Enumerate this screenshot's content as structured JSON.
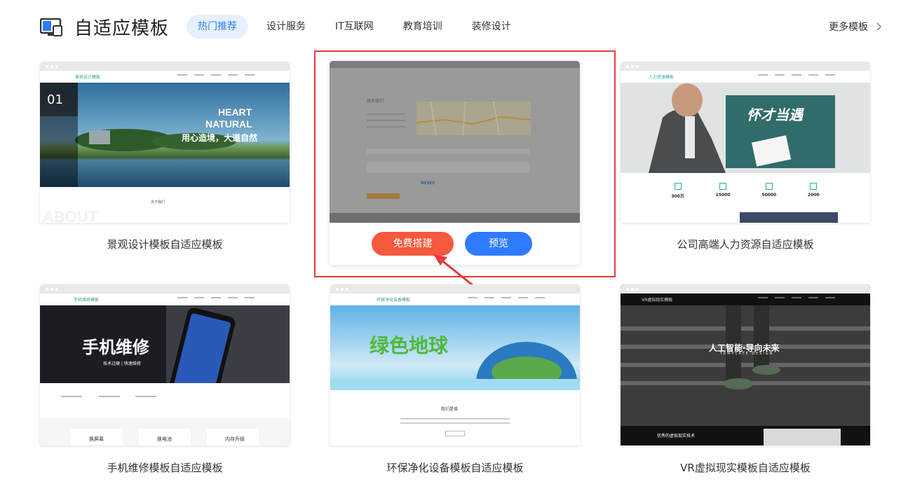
{
  "header": {
    "brand": "自适应模板",
    "tabs": [
      "热门推荐",
      "设计服务",
      "IT互联网",
      "教育培训",
      "装修设计"
    ],
    "more": "更多模板"
  },
  "cards": [
    {
      "caption": "景观设计模板自适应模板",
      "site_name": "景观设计模板",
      "slide_no": "01",
      "hero_line1": "HEART",
      "hero_line2": "NATURAL",
      "hero_cn": "用心造境，大道自然",
      "section_about": "关于我们",
      "watermark": "ABOUT"
    },
    {
      "caption": "公司高端人力资源自适应模板",
      "site_name": "人力资源模板",
      "slogan": "怀才当遇",
      "stats": [
        "300万",
        "15000",
        "50000",
        "2000"
      ]
    },
    {
      "caption": "手机维修模板自适应模板",
      "site_name": "手机维修模板",
      "hero": "手机维修",
      "sub": "技术过硬 | 快速维修",
      "services": [
        "换屏幕",
        "换电池",
        "内存升级"
      ]
    },
    {
      "caption": "环保净化设备模板自适应模板",
      "site_name": "环保净化设备模板",
      "hero": "绿色地球",
      "section": "我们是谁"
    },
    {
      "caption": "VR虚拟现实模板自适应模板",
      "site_name": "VR虚拟现实模板",
      "hero": "人工智能·导向未来",
      "sub": "TEMPLATE DESIGN",
      "section": "优秀的虚拟现实技术"
    }
  ],
  "featured": {
    "contact_title": "联系我们",
    "map_label": "NEWS",
    "free_build": "免费搭建",
    "preview": "预览"
  }
}
